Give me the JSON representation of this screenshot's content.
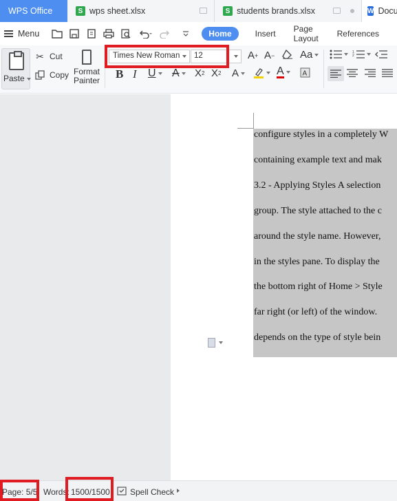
{
  "tabs": {
    "app": "WPS Office",
    "files": [
      {
        "name": "wps sheet.xlsx",
        "icon": "S"
      },
      {
        "name": "students brands.xlsx",
        "icon": "S"
      }
    ],
    "doc": {
      "name": "Docu",
      "icon": "W"
    }
  },
  "menu": {
    "menu_label": "Menu",
    "ribbon_tabs": [
      "Home",
      "Insert",
      "Page Layout",
      "References"
    ]
  },
  "ribbon": {
    "paste": "Paste",
    "cut": "Cut",
    "copy": "Copy",
    "format_painter_1": "Format",
    "format_painter_2": "Painter",
    "font_name": "Times New Roman",
    "font_size": "12"
  },
  "document": {
    "lines": [
      "configure styles in a completely W",
      "containing example text and mak",
      "3.2 - Applying Styles A selection",
      "group. The style attached to the c",
      "around the style name. However,",
      "in the styles pane. To display the",
      "the bottom right of Home > Style",
      "far right (or left) of the window.",
      "depends on the type of style bein"
    ]
  },
  "status": {
    "page": "Page: 5/5",
    "words_label": "Words:",
    "words_value": "1500/1500",
    "spell_check": "Spell Check"
  },
  "colors": {
    "accent": "#4d8ef0",
    "highlight_box": "#e01b22",
    "selection": "#c6c6c6",
    "sheet_icon": "#2fa84f",
    "doc_icon": "#2b6fde"
  }
}
